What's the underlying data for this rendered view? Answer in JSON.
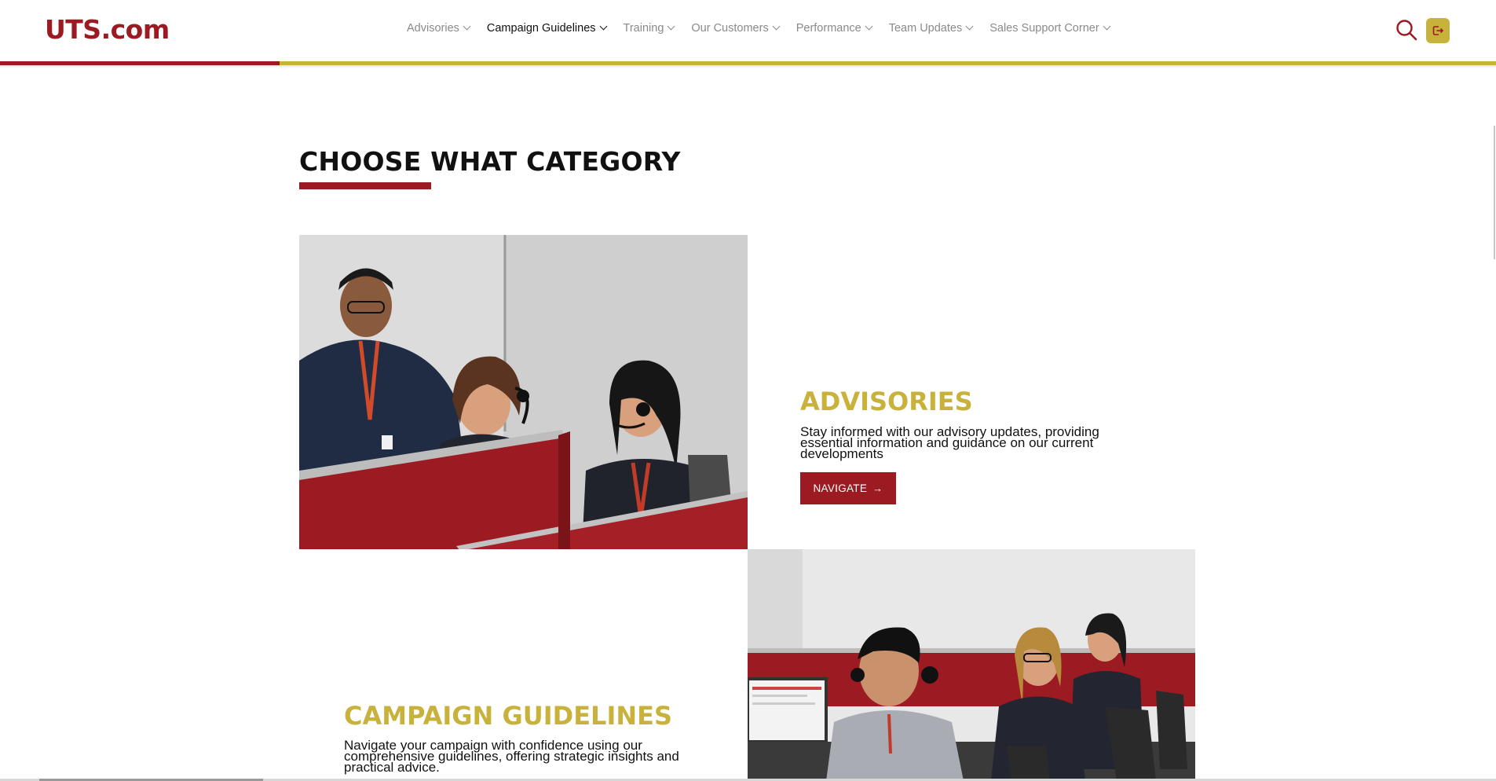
{
  "header": {
    "logo": "UTS.com",
    "nav": [
      {
        "label": "Advisories",
        "active": false
      },
      {
        "label": "Campaign Guidelines",
        "active": true
      },
      {
        "label": "Training",
        "active": false
      },
      {
        "label": "Our Customers",
        "active": false
      },
      {
        "label": "Performance",
        "active": false
      },
      {
        "label": "Team Updates",
        "active": false
      },
      {
        "label": "Sales Support Corner",
        "active": false
      }
    ],
    "search_icon": "search-icon",
    "logout_icon": "logout-icon"
  },
  "colors": {
    "brand_red": "#9c1b22",
    "brand_gold": "#c9b23c"
  },
  "section": {
    "title": "CHOOSE WHAT CATEGORY"
  },
  "categories": [
    {
      "title": "ADVISORIES",
      "description": "Stay informed with our advisory updates, providing essential information and guidance on our current developments",
      "button": "NAVIGATE",
      "button_icon": "arrow-right-icon"
    },
    {
      "title": "CAMPAIGN GUIDELINES",
      "description": "Navigate your campaign with confidence using our comprehensive guidelines, offering strategic insights and practical advice."
    }
  ]
}
